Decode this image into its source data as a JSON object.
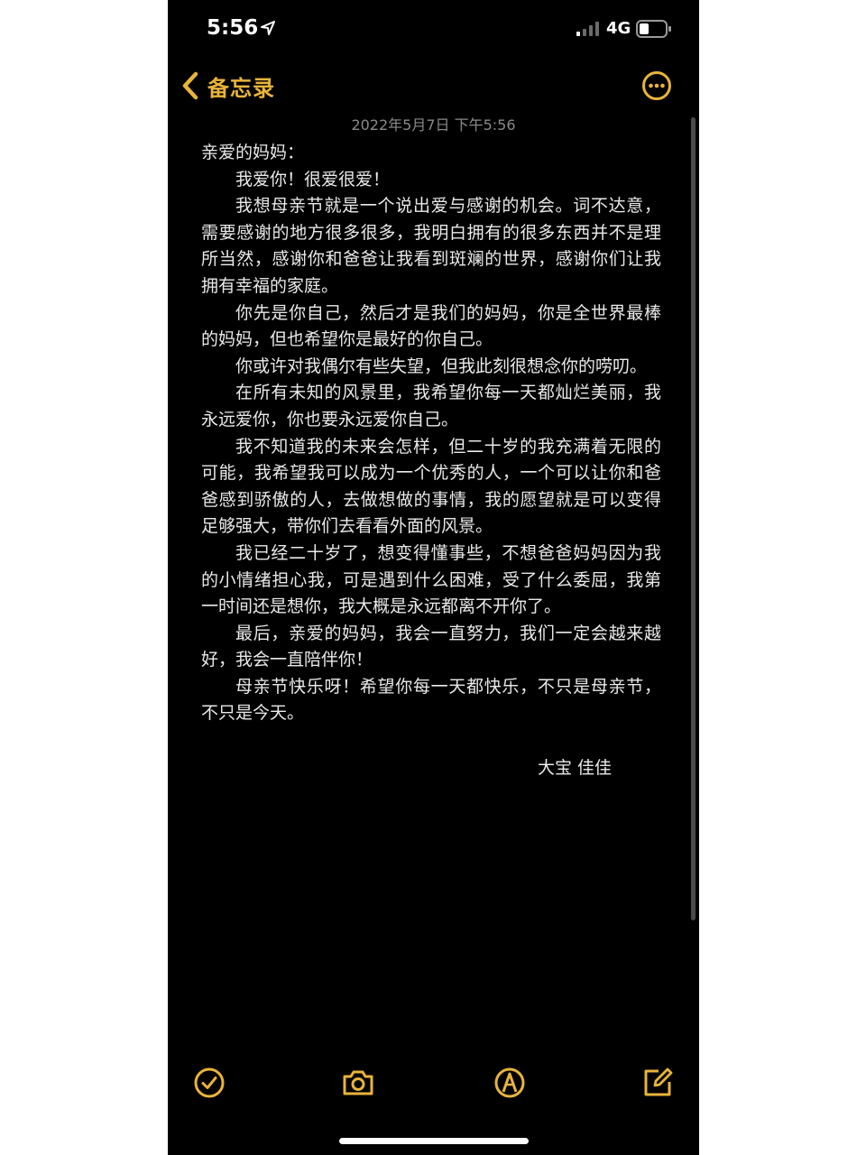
{
  "status_bar": {
    "time": "5:56",
    "network": "4G"
  },
  "nav": {
    "back_label": "备忘录"
  },
  "note": {
    "date": "2022年5月7日 下午5:56",
    "paragraphs": [
      "亲爱的妈妈：",
      "我爱你！很爱很爱！",
      "我想母亲节就是一个说出爱与感谢的机会。词不达意，需要感谢的地方很多很多，我明白拥有的很多东西并不是理所当然，感谢你和爸爸让我看到斑斓的世界，感谢你们让我拥有幸福的家庭。",
      "你先是你自己，然后才是我们的妈妈，你是全世界最棒的妈妈，但也希望你是最好的你自己。",
      "你或许对我偶尔有些失望，但我此刻很想念你的唠叨。",
      "在所有未知的风景里，我希望你每一天都灿烂美丽，我永远爱你，你也要永远爱你自己。",
      "我不知道我的未来会怎样，但二十岁的我充满着无限的可能，我希望我可以成为一个优秀的人，一个可以让你和爸爸感到骄傲的人，去做想做的事情，我的愿望就是可以变得足够强大，带你们去看看外面的风景。",
      "我已经二十岁了，想变得懂事些，不想爸爸妈妈因为我的小情绪担心我，可是遇到什么困难，受了什么委屈，我第一时间还是想你，我大概是永远都离不开你了。",
      "最后，亲爱的妈妈，我会一直努力，我们一定会越来越好，我会一直陪伴你！",
      "母亲节快乐呀！希望你每一天都快乐，不只是母亲节，不只是今天。"
    ],
    "signature": "大宝 佳佳"
  },
  "icons": {
    "location": "location-arrow-icon",
    "signal": "cellular-signal-icon",
    "battery": "battery-icon",
    "back": "chevron-left-icon",
    "more": "ellipsis-circle-icon",
    "checklist": "checkmark-circle-icon",
    "camera": "camera-icon",
    "markup": "pen-tip-circle-icon",
    "compose": "compose-icon"
  },
  "colors": {
    "accent": "#e8b43a",
    "background": "#000000",
    "text": "#e9e9e9",
    "date": "#8a8a8a"
  }
}
